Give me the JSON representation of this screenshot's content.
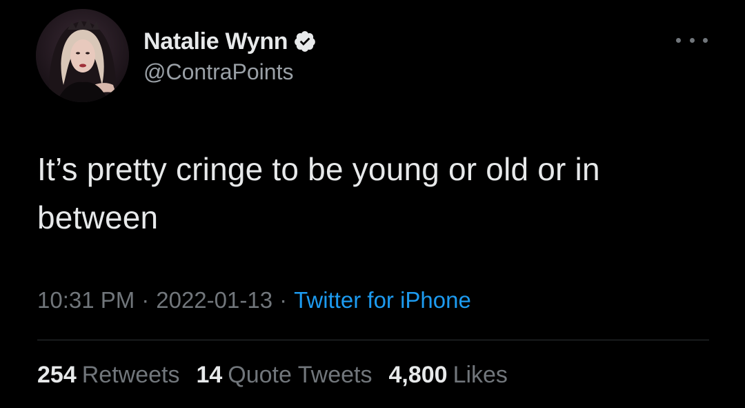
{
  "author": {
    "display_name": "Natalie Wynn",
    "handle": "@ContraPoints",
    "verified": true
  },
  "tweet": {
    "text": "It’s pretty cringe to be young or old or in between",
    "time": "10:31 PM",
    "date": "2022-01-13",
    "source": "Twitter for iPhone",
    "separator": "·"
  },
  "stats": {
    "retweets": {
      "count": "254",
      "label": "Retweets"
    },
    "quotes": {
      "count": "14",
      "label": "Quote Tweets"
    },
    "likes": {
      "count": "4,800",
      "label": "Likes"
    }
  },
  "icons": {
    "verified": "verified-badge-icon",
    "more": "more-options-icon"
  },
  "colors": {
    "background": "#000000",
    "primary_text": "#e7e9ea",
    "secondary_text": "#71767b",
    "link": "#1d9bf0",
    "divider": "#2f3336"
  }
}
